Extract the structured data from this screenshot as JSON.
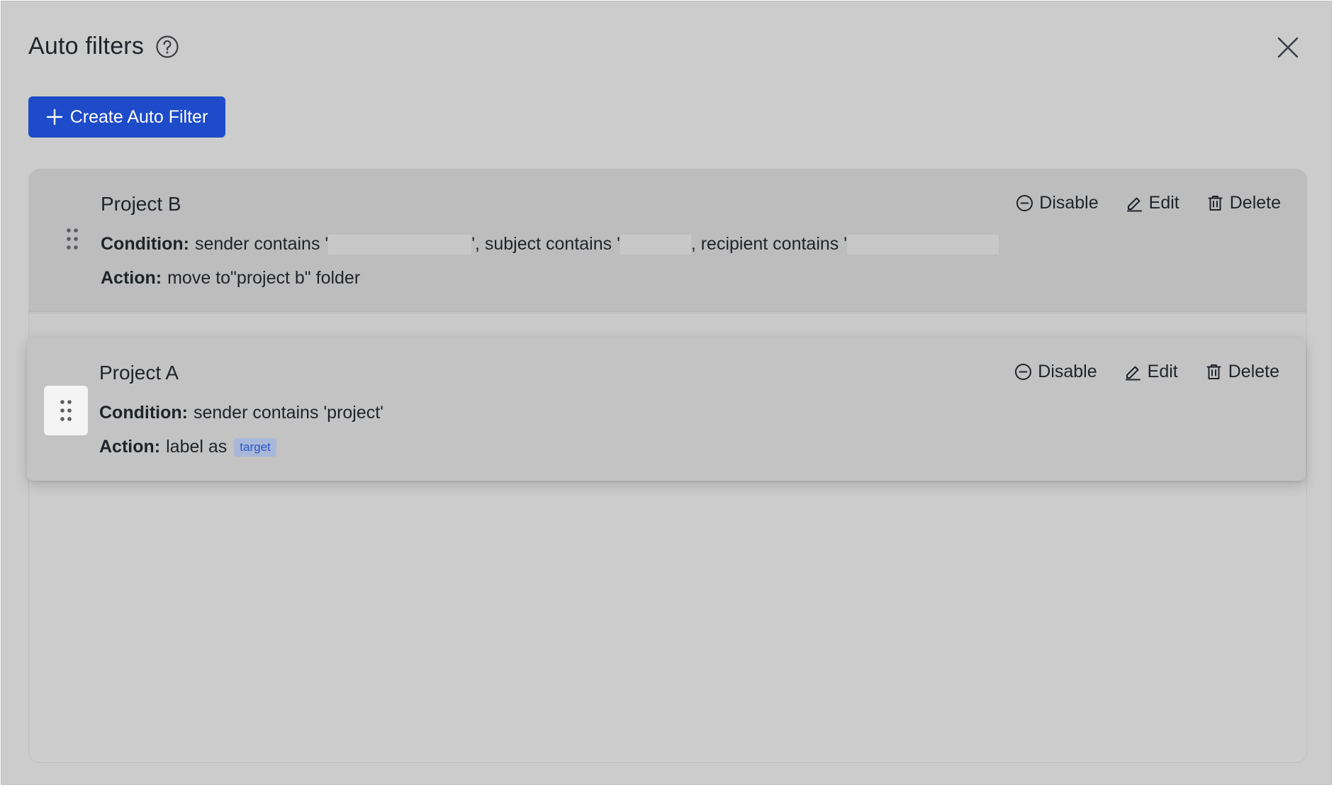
{
  "dialog": {
    "title": "Auto filters",
    "help_icon": "help-circle-icon",
    "close_icon": "close-icon"
  },
  "create_button": {
    "label": "Create Auto Filter",
    "icon": "plus-icon",
    "color": "#1d4bc9"
  },
  "actions": {
    "disable": "Disable",
    "edit": "Edit",
    "delete": "Delete",
    "disable_icon": "minus-circle-icon",
    "edit_icon": "pencil-icon",
    "delete_icon": "trash-icon"
  },
  "filters": [
    {
      "name": "Project B",
      "condition_label": "Condition:",
      "condition_parts": [
        "sender contains '",
        "', subject contains '",
        ", recipient contains '"
      ],
      "action_label": "Action:",
      "action_text": "move to\"project b\" folder",
      "state": "idle"
    },
    {
      "name": "Project A",
      "condition_label": "Condition:",
      "condition_text": "sender contains 'project'",
      "action_label": "Action:",
      "action_text": "label as",
      "action_tag": "target",
      "state": "dragging"
    }
  ]
}
